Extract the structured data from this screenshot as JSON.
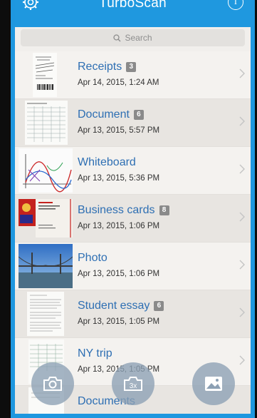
{
  "header": {
    "title": "TurboScan"
  },
  "search": {
    "placeholder": "Search"
  },
  "documents": [
    {
      "name": "Receipts",
      "count": "3",
      "date": "Apr 14, 2015, 1:24 AM"
    },
    {
      "name": "Document",
      "count": "6",
      "date": "Apr 13, 2015, 5:57 PM"
    },
    {
      "name": "Whiteboard",
      "count": "",
      "date": "Apr 13, 2015, 5:36 PM"
    },
    {
      "name": "Business cards",
      "count": "8",
      "date": "Apr 13, 2015, 1:06 PM"
    },
    {
      "name": "Photo",
      "count": "",
      "date": "Apr 13, 2015, 1:06 PM"
    },
    {
      "name": "Student essay",
      "count": "6",
      "date": "Apr 13, 2015, 1:05 PM"
    },
    {
      "name": "NY trip",
      "count": "",
      "date": "Apr 13, 2015, 1:05 PM"
    },
    {
      "name": "Documents",
      "count": "",
      "date": ""
    }
  ],
  "fabs": {
    "multi_label": "3x"
  },
  "colors": {
    "accent": "#1f98df",
    "title_text": "#2e6fb3",
    "badge": "#8a8a8a"
  },
  "icons": [
    "gear-icon",
    "info-icon",
    "search-icon",
    "chevron-right-icon",
    "camera-icon",
    "batch-camera-icon",
    "gallery-icon"
  ]
}
